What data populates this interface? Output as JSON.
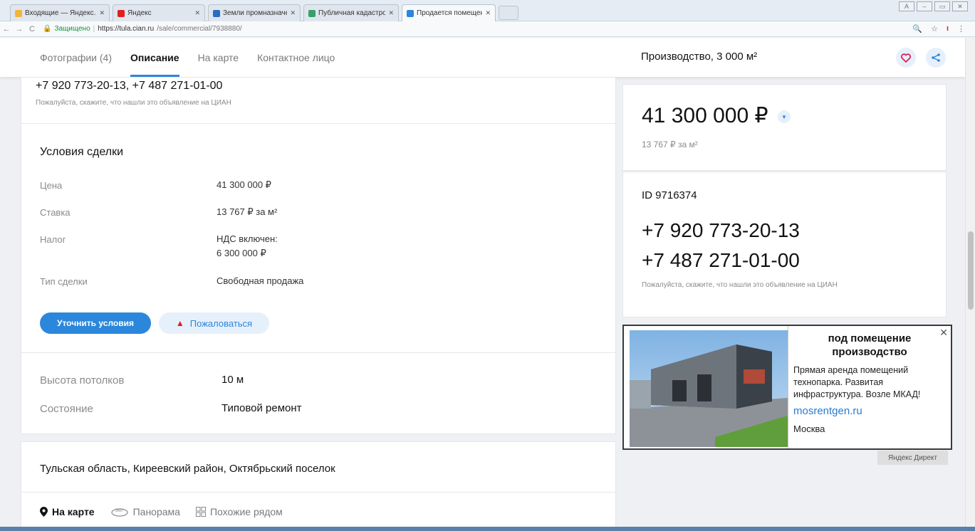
{
  "browser": {
    "tabs": [
      {
        "title": "Входящие — Яндекс.По",
        "favicon_color": "#f3b43a"
      },
      {
        "title": "Яндекс",
        "favicon_color": "#e0201f"
      },
      {
        "title": "Земли промназначени",
        "favicon_color": "#2b6cc4"
      },
      {
        "title": "Публичная кадастрова",
        "favicon_color": "#38a169"
      },
      {
        "title": "Продается помещени",
        "favicon_color": "#2b87db",
        "active": true
      }
    ],
    "address": {
      "secure_label": "Защищено",
      "host": "https://tula.cian.ru",
      "path": "/sale/commercial/7938880/"
    }
  },
  "header": {
    "tabs": [
      "Фотографии (4)",
      "Описание",
      "На карте",
      "Контактное лицо"
    ],
    "active_tab": "Описание",
    "title": "Производство, 3 000 м²"
  },
  "contact_strip": {
    "phones": "+7 920 773-20-13, +7 487 271-01-00",
    "note": "Пожалуйста, скажите, что нашли это объявление на ЦИАН"
  },
  "deal": {
    "title": "Условия сделки",
    "rows": [
      {
        "label": "Цена",
        "value": "41 300 000 ₽"
      },
      {
        "label": "Ставка",
        "value": "13 767 ₽ за м²"
      },
      {
        "label": "Налог",
        "value": "НДС включен:",
        "value2": "6 300 000 ₽"
      },
      {
        "label": "Тип сделки",
        "value": "Свободная продажа"
      }
    ],
    "primary_button": "Уточнить условия",
    "complain_button": "Пожаловаться"
  },
  "details": [
    {
      "label": "Высота потолков",
      "value": "10 м"
    },
    {
      "label": "Состояние",
      "value": "Типовой ремонт"
    }
  ],
  "location": {
    "address": "Тульская область, Киреевский район, Октябрьский поселок",
    "links": [
      "На карте",
      "Панорама",
      "Похожие рядом"
    ]
  },
  "price_card": {
    "price": "41 300 000 ₽",
    "per_meter": "13 767 ₽ за м²"
  },
  "contact_card": {
    "id": "ID 9716374",
    "phone1": "+7 920 773-20-13",
    "phone2": "+7 487 271-01-00",
    "note": "Пожалуйста, скажите, что нашли это объявление на ЦИАН"
  },
  "ad": {
    "title": "под помещение производство",
    "text": "Прямая аренда помещений технопарка. Развитая инфраструктура. Возле МКАД!",
    "link": "mosrentgen.ru",
    "city": "Москва",
    "label": "Яндекс Директ"
  },
  "colors": {
    "accent": "#2b87db",
    "accent_light": "#e6f0fb",
    "warning": "#e0201f",
    "muted_text": "#8a8a8a"
  }
}
